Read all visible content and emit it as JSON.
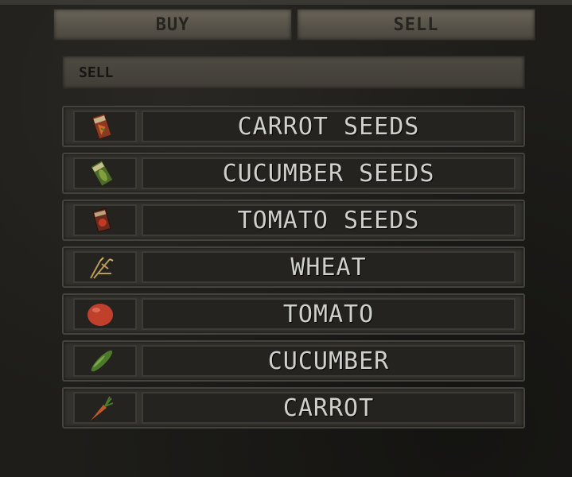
{
  "tabs": {
    "buy_label": "BUY",
    "sell_label": "SELL"
  },
  "section": {
    "title": "SELL"
  },
  "items": [
    {
      "label": "CARROT SEEDS",
      "icon": "carrot-seeds-icon"
    },
    {
      "label": "CUCUMBER SEEDS",
      "icon": "cucumber-seeds-icon"
    },
    {
      "label": "TOMATO SEEDS",
      "icon": "tomato-seeds-icon"
    },
    {
      "label": "WHEAT",
      "icon": "wheat-icon"
    },
    {
      "label": "TOMATO",
      "icon": "tomato-icon"
    },
    {
      "label": "CUCUMBER",
      "icon": "cucumber-icon"
    },
    {
      "label": "CARROT",
      "icon": "carrot-icon"
    }
  ]
}
